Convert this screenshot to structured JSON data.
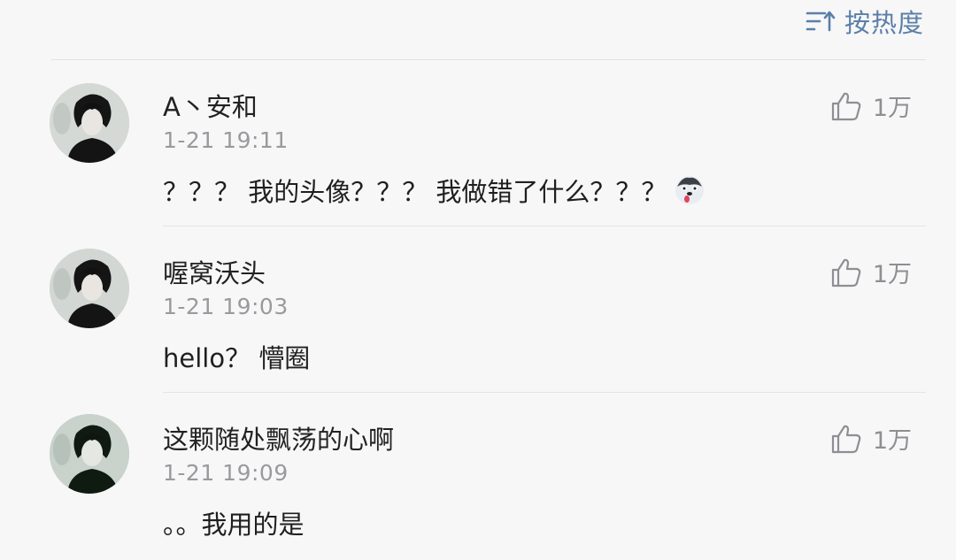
{
  "sort": {
    "label": "按热度",
    "icon": "sort-lines-icon"
  },
  "comments": [
    {
      "username": "A丶安和",
      "time": "1-21 19:11",
      "text": "？？？ 我的头像？？？ 我做错了什么？？？",
      "emoji": "husky-emoji",
      "likes": "1万"
    },
    {
      "username": "喔窝沃头",
      "time": "1-21 19:03",
      "text": "hello？ 懵圈",
      "likes": "1万"
    },
    {
      "username": "这颗随处飘荡的心啊",
      "time": "1-21 19:09",
      "text": "。。我用的是",
      "likes": "1万"
    }
  ],
  "colors": {
    "accent": "#5b7fa8",
    "text": "#222222",
    "muted": "#9a9a9e",
    "background": "#f7f7f8"
  }
}
